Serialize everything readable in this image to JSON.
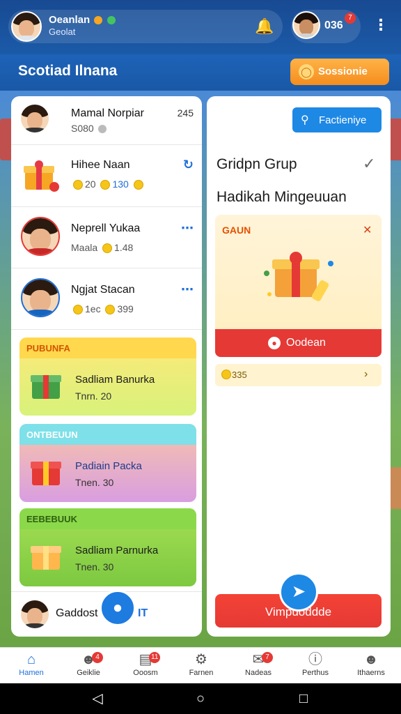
{
  "topbar": {
    "profile_name": "Oeanlan",
    "profile_status": "Geolat",
    "friend_count": "036",
    "friend_badge": "7"
  },
  "header": {
    "title": "Scotiad Ilnana",
    "session_button": "Sossionie"
  },
  "left_panel": {
    "users": [
      {
        "name": "Mamal Norpiar",
        "sub": "S080",
        "meta": "245"
      },
      {
        "name": "Hihee Naan",
        "coins": [
          "20",
          "130"
        ]
      },
      {
        "name": "Neprell Yukaa",
        "sub": "Maala",
        "coins": [
          "1.48"
        ]
      },
      {
        "name": "Ngjat Stacan",
        "coins": [
          "1ec",
          "399"
        ]
      }
    ],
    "cards": [
      {
        "header": "PUBUNFA",
        "title": "Sadliam Banurka",
        "sub": "Tnrn. 20"
      },
      {
        "header": "ONTBEUUN",
        "title": "Padiain Packa",
        "sub": "Tnen. 30"
      },
      {
        "header": "EEBEBUUK",
        "title": "Sadliam Parnurka",
        "sub": "Tnen. 30"
      }
    ],
    "footer_user": "Gaddost",
    "footer_tag": "IT"
  },
  "right_panel": {
    "search_button": "Factieniye",
    "title": "Gridpn Grup",
    "subtitle": "Hadikah Mingeuuan",
    "gift_label": "GAUN",
    "claim_button": "Oodean",
    "coin_value": "335",
    "main_button": "Vimpuoddde"
  },
  "bottom_nav": [
    {
      "label": "Hamen",
      "icon": "home-icon",
      "active": true
    },
    {
      "label": "Geiklie",
      "icon": "user-add-icon",
      "badge": "4"
    },
    {
      "label": "Ooosm",
      "icon": "inbox-icon",
      "badge": "11"
    },
    {
      "label": "Farnen",
      "icon": "gear-icon"
    },
    {
      "label": "Nadeas",
      "icon": "chat-icon",
      "badge": "7"
    },
    {
      "label": "Perthus",
      "icon": "info-icon"
    },
    {
      "label": "Ithaerns",
      "icon": "profile-icon"
    }
  ],
  "colors": {
    "primary": "#1e6fd9",
    "accent_orange": "#f58d1d",
    "accent_red": "#e53935"
  }
}
